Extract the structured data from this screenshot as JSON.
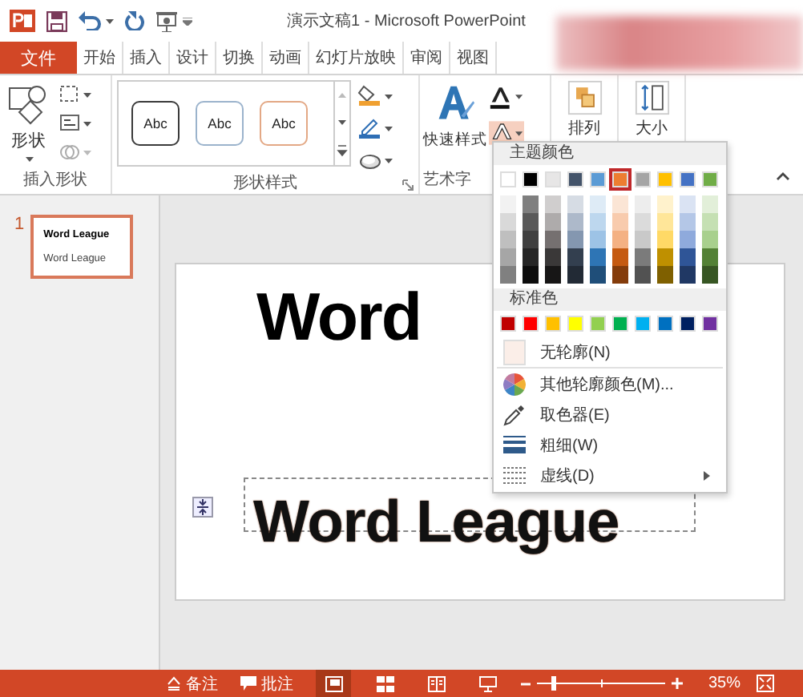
{
  "title_bar": {
    "title": "演示文稿1 - Microsoft PowerPoint"
  },
  "file_tab": "文件",
  "tabs": [
    {
      "label": "开始",
      "selected": false
    },
    {
      "label": "插入",
      "selected": false
    },
    {
      "label": "设计",
      "selected": false
    },
    {
      "label": "切换",
      "selected": false
    },
    {
      "label": "动画",
      "selected": false
    },
    {
      "label": "幻灯片放映",
      "selected": false
    },
    {
      "label": "审阅",
      "selected": false
    },
    {
      "label": "视图",
      "selected": false
    }
  ],
  "ribbon": {
    "insert_shapes": {
      "label": "插入形状",
      "shape_button": "形状"
    },
    "shape_styles": {
      "label": "形状样式",
      "styles": [
        {
          "label": "Abc",
          "color": "#3a3a3a"
        },
        {
          "label": "Abc",
          "color": "#9bb3cc"
        },
        {
          "label": "Abc",
          "color": "#e3a885"
        }
      ]
    },
    "wordart_styles": {
      "label": "艺术字",
      "quick_styles": "快速样式",
      "text_outline_pressed": true
    },
    "arrange": "排列",
    "size": "大小"
  },
  "thumbnails": [
    {
      "number": "1",
      "lines": [
        "Word League",
        "Word League"
      ],
      "selected": true
    }
  ],
  "slide": {
    "title": "Word",
    "textbox": "Word League"
  },
  "outline_menu": {
    "theme_header": "主题颜色",
    "theme_colors": [
      {
        "color": "#ffffff",
        "selected": false,
        "shades": [
          {
            "color": "#f2f2f2"
          },
          {
            "color": "#d9d9d9"
          },
          {
            "color": "#bfbfbf"
          },
          {
            "color": "#a6a6a6"
          },
          {
            "color": "#808080"
          }
        ]
      },
      {
        "color": "#000000",
        "selected": false,
        "shades": [
          {
            "color": "#7f7f7f"
          },
          {
            "color": "#595959"
          },
          {
            "color": "#404040"
          },
          {
            "color": "#262626"
          },
          {
            "color": "#0d0d0d"
          }
        ]
      },
      {
        "color": "#e7e6e6",
        "selected": false,
        "shades": [
          {
            "color": "#d0cece"
          },
          {
            "color": "#aeabab"
          },
          {
            "color": "#757070"
          },
          {
            "color": "#3a3838"
          },
          {
            "color": "#171616"
          }
        ]
      },
      {
        "color": "#44546a",
        "selected": false,
        "shades": [
          {
            "color": "#d6dce4"
          },
          {
            "color": "#adb9ca"
          },
          {
            "color": "#8497b0"
          },
          {
            "color": "#333f4f"
          },
          {
            "color": "#222a35"
          }
        ]
      },
      {
        "color": "#5b9bd5",
        "selected": false,
        "shades": [
          {
            "color": "#deebf6"
          },
          {
            "color": "#bdd7ee"
          },
          {
            "color": "#9dc3e6"
          },
          {
            "color": "#2e75b5"
          },
          {
            "color": "#1f4e79"
          }
        ]
      },
      {
        "color": "#ed7d31",
        "selected": true,
        "shades": [
          {
            "color": "#fbe5d5"
          },
          {
            "color": "#f8cbad"
          },
          {
            "color": "#f4b183"
          },
          {
            "color": "#c55a11"
          },
          {
            "color": "#843c0b"
          }
        ]
      },
      {
        "color": "#a5a5a5",
        "selected": false,
        "shades": [
          {
            "color": "#ededed"
          },
          {
            "color": "#dbdbdb"
          },
          {
            "color": "#c9c9c9"
          },
          {
            "color": "#7b7b7b"
          },
          {
            "color": "#525252"
          }
        ]
      },
      {
        "color": "#ffc000",
        "selected": false,
        "shades": [
          {
            "color": "#fff2cc"
          },
          {
            "color": "#ffe699"
          },
          {
            "color": "#ffd966"
          },
          {
            "color": "#bf9000"
          },
          {
            "color": "#7f6000"
          }
        ]
      },
      {
        "color": "#4472c4",
        "selected": false,
        "shades": [
          {
            "color": "#dae3f3"
          },
          {
            "color": "#b4c7e7"
          },
          {
            "color": "#8faadc"
          },
          {
            "color": "#2f5597"
          },
          {
            "color": "#203864"
          }
        ]
      },
      {
        "color": "#70ad47",
        "selected": false,
        "shades": [
          {
            "color": "#e2efd9"
          },
          {
            "color": "#c5e0b3"
          },
          {
            "color": "#a8d08d"
          },
          {
            "color": "#538135"
          },
          {
            "color": "#375623"
          }
        ]
      }
    ],
    "standard_header": "标准色",
    "standard_colors": [
      {
        "color": "#c00000"
      },
      {
        "color": "#ff0000"
      },
      {
        "color": "#ffc000"
      },
      {
        "color": "#ffff00"
      },
      {
        "color": "#92d050"
      },
      {
        "color": "#00b050"
      },
      {
        "color": "#00b0f0"
      },
      {
        "color": "#0070c0"
      },
      {
        "color": "#002060"
      },
      {
        "color": "#7030a0"
      }
    ],
    "items": [
      {
        "kind": "no_outline",
        "label": "无轮廓(N)",
        "submenu": false
      },
      {
        "kind": "more_colors",
        "label": "其他轮廓颜色(M)...",
        "submenu": false
      },
      {
        "kind": "eyedropper",
        "label": "取色器(E)",
        "submenu": false
      },
      {
        "kind": "weight",
        "label": "粗细(W)",
        "submenu": false
      },
      {
        "kind": "dashes",
        "label": "虚线(D)",
        "submenu": true
      }
    ]
  },
  "status_bar": {
    "notes": "备注",
    "comments": "批注",
    "views": [
      {
        "kind": "normal",
        "selected": true
      },
      {
        "kind": "sorter",
        "selected": false
      },
      {
        "kind": "reading",
        "selected": false
      },
      {
        "kind": "slideshow",
        "selected": false
      }
    ],
    "zoom": {
      "level": 0.12
    },
    "zoom_percent": "35%"
  }
}
